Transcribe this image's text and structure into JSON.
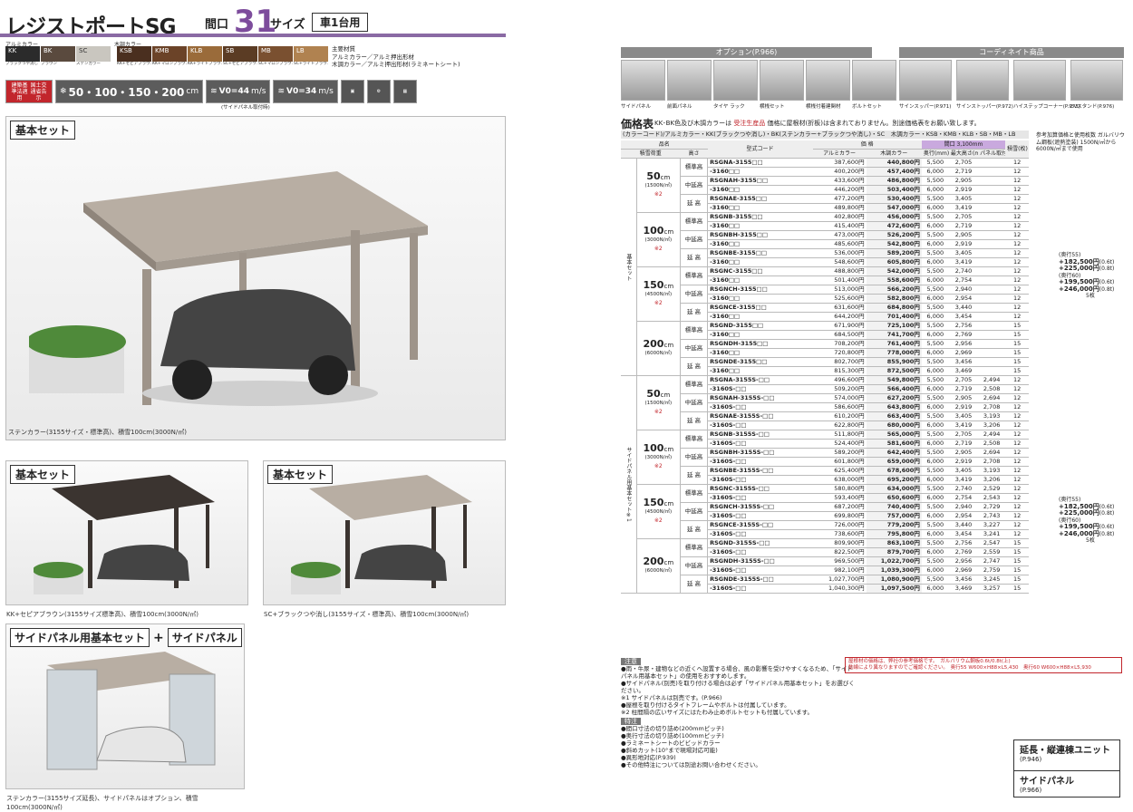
{
  "header": {
    "title": "レジストポートSG",
    "maguchi": "間口",
    "size_num": "31",
    "size_unit": "サイズ",
    "badge": "車1台用"
  },
  "colors": {
    "label_alumi": "アルミカラー",
    "label_wood": "木調カラー",
    "alumi": [
      {
        "code": "KK",
        "name": "ブラックつや消し",
        "hex": "#2b2b2b"
      },
      {
        "code": "BK",
        "name": "ブラウン",
        "hex": "#5a4a3e"
      },
      {
        "code": "SC",
        "name": "ステンカラー",
        "hex": "#c9c6bf"
      }
    ],
    "wood": [
      {
        "code": "KSB",
        "name": "KK+セピアブラウン",
        "hex": "#4a2f1f"
      },
      {
        "code": "KMB",
        "name": "KK+マロンブラウン",
        "hex": "#6b4328"
      },
      {
        "code": "KLB",
        "name": "KK+ライトブラウン",
        "hex": "#9a6b3a"
      },
      {
        "code": "SB",
        "name": "SC+セピアブラウン",
        "hex": "#5b3c24"
      },
      {
        "code": "MB",
        "name": "SC+マロンブラウン",
        "hex": "#7a5030"
      },
      {
        "code": "LB",
        "name": "SC+ライトブラウン",
        "hex": "#b08250"
      }
    ]
  },
  "material": {
    "label": "主要材質",
    "line1": "アルミカラー／アルミ押出形材",
    "line2": "木調カラー／アルミ押出形材(ラミネートシート)"
  },
  "icons": {
    "law": "建築基準法適用",
    "law_sub": "国土交通省告示",
    "snow": "50・100・150・200",
    "snow_unit": "cm",
    "wind1": "V0=44",
    "wind2": "V0=34",
    "unit": "m/s",
    "note": "(サイドパネル取付時)"
  },
  "panels": {
    "main_label": "基本セット",
    "main_caption": "ステンカラー(3155サイズ・標準高)、積雪100cm(3000N/㎡)",
    "p2_label": "基本セット",
    "p2_caption": "KK+セピアブラウン(3155サイズ標準高)、積雪100cm(3000N/㎡)",
    "p3_label": "基本セット",
    "p3_caption": "SC+ブラックつや消し(3155サイズ・標準高)、積雪100cm(3000N/㎡)",
    "p4_label1": "サイドパネル用基本セット",
    "p4_plus": "+",
    "p4_label2": "サイドパネル",
    "p4_caption": "ステンカラー(3155サイズ延長)、サイドパネルはオプション、積雪100cm(3000N/㎡)"
  },
  "options": {
    "head": "オプション(P.966)",
    "coord": "コーディネイト商品",
    "items": [
      "サイドパネル",
      "前面パネル",
      "タイヤ ラック",
      "横桟セット",
      "横桟付着建関材",
      "ボルトセット",
      "サインスッパー(P.971)",
      "サインストッパー(P.972)",
      "ハイステップコーナー(P.973)",
      "EVスタンド(P.976)"
    ]
  },
  "price": {
    "title": "価格表",
    "note1": "KK･BK色及び木調カラーは",
    "note_red": "受注生産品",
    "note2": "価格に屋根材(折板)は含まれておりません。別途価格表をお願い致します。",
    "kk_line": "(カラーコード)/アルミカラー・KK(ブラックつや消し)・BK(ステンカラー+ブラックつや消し)・SC　木調カラー・KSB・KMB・KLB・SB・MB・LB",
    "h": {
      "name": "品名",
      "snow": "積雪荷重",
      "height": "高さ",
      "code": "型式コード",
      "alumi": "アルミカラー",
      "wood": "木調カラー",
      "depth": "奥行(mm)",
      "maxh": "最大高さ(mm)",
      "panelh": "パネル取付高さ(mm)",
      "roof": "積雪(枚)",
      "maguchi": "間口 3,100mm"
    }
  },
  "groups": [
    {
      "label": "基本セット",
      "blocks": [
        {
          "snow": "50",
          "kN": "(1500N/㎡)",
          "star": "※2",
          "rows": [
            [
              "標準高",
              "RSGNA-3155□□",
              "387,600円",
              "440,800円",
              "5,500",
              "2,705",
              "12"
            ],
            [
              "",
              "-3160□□",
              "400,200円",
              "457,400円",
              "6,000",
              "2,719",
              "12"
            ],
            [
              "中延高",
              "RSGNAH-3155□□",
              "433,600円",
              "486,800円",
              "5,500",
              "2,905",
              "12"
            ],
            [
              "",
              "-3160□□",
              "446,200円",
              "503,400円",
              "6,000",
              "2,919",
              "12"
            ],
            [
              "延 高",
              "RSGNAE-3155□□",
              "477,200円",
              "530,400円",
              "5,500",
              "3,405",
              "12"
            ],
            [
              "",
              "-3160□□",
              "489,800円",
              "547,000円",
              "6,000",
              "3,419",
              "12"
            ]
          ]
        },
        {
          "snow": "100",
          "kN": "(3000N/㎡)",
          "star": "※2",
          "rows": [
            [
              "標準高",
              "RSGNB-3155□□",
              "402,800円",
              "456,000円",
              "5,500",
              "2,705",
              "12"
            ],
            [
              "",
              "-3160□□",
              "415,400円",
              "472,600円",
              "6,000",
              "2,719",
              "12"
            ],
            [
              "中延高",
              "RSGNBH-3155□□",
              "473,000円",
              "526,200円",
              "5,500",
              "2,905",
              "12"
            ],
            [
              "",
              "-3160□□",
              "485,600円",
              "542,800円",
              "6,000",
              "2,919",
              "12"
            ],
            [
              "延 高",
              "RSGNBE-3155□□",
              "536,000円",
              "589,200円",
              "5,500",
              "3,405",
              "12"
            ],
            [
              "",
              "-3160□□",
              "548,600円",
              "605,800円",
              "6,000",
              "3,419",
              "12"
            ]
          ]
        },
        {
          "snow": "150",
          "kN": "(4500N/㎡)",
          "star": "※2",
          "rows": [
            [
              "標準高",
              "RSGNC-3155□□",
              "488,800円",
              "542,000円",
              "5,500",
              "2,740",
              "12"
            ],
            [
              "",
              "-3160□□",
              "501,400円",
              "558,600円",
              "6,000",
              "2,754",
              "12"
            ],
            [
              "中延高",
              "RSGNCH-3155□□",
              "513,000円",
              "566,200円",
              "5,500",
              "2,940",
              "12"
            ],
            [
              "",
              "-3160□□",
              "525,600円",
              "582,800円",
              "6,000",
              "2,954",
              "12"
            ],
            [
              "延 高",
              "RSGNCE-3155□□",
              "631,600円",
              "684,800円",
              "5,500",
              "3,440",
              "12"
            ],
            [
              "",
              "-3160□□",
              "644,200円",
              "701,400円",
              "6,000",
              "3,454",
              "12"
            ]
          ]
        },
        {
          "snow": "200",
          "kN": "(6000N/㎡)",
          "star": "",
          "rows": [
            [
              "標準高",
              "RSGND-3155□□",
              "671,900円",
              "725,100円",
              "5,500",
              "2,756",
              "15"
            ],
            [
              "",
              "-3160□□",
              "684,500円",
              "741,700円",
              "6,000",
              "2,769",
              "15"
            ],
            [
              "中延高",
              "RSGNDH-3155□□",
              "708,200円",
              "761,400円",
              "5,500",
              "2,956",
              "15"
            ],
            [
              "",
              "-3160□□",
              "720,800円",
              "778,000円",
              "6,000",
              "2,969",
              "15"
            ],
            [
              "延 高",
              "RSGNDE-3155□□",
              "802,700円",
              "855,900円",
              "5,500",
              "3,456",
              "15"
            ],
            [
              "",
              "-3160□□",
              "815,300円",
              "872,500円",
              "6,000",
              "3,469",
              "15"
            ]
          ]
        }
      ]
    },
    {
      "label": "サイドパネル用基本セット※1",
      "blocks": [
        {
          "snow": "50",
          "kN": "(1500N/㎡)",
          "star": "※2",
          "rows": [
            [
              "標準高",
              "RSGNA-3155S-□□",
              "496,600円",
              "549,800円",
              "5,500",
              "2,705",
              "2,494",
              "12"
            ],
            [
              "",
              "-3160S-□□",
              "509,200円",
              "566,400円",
              "6,000",
              "2,719",
              "2,508",
              "12"
            ],
            [
              "中延高",
              "RSGNAH-3155S-□□",
              "574,000円",
              "627,200円",
              "5,500",
              "2,905",
              "2,694",
              "12"
            ],
            [
              "",
              "-3160S-□□",
              "586,600円",
              "643,800円",
              "6,000",
              "2,919",
              "2,708",
              "12"
            ],
            [
              "延 高",
              "RSGNAE-3155S-□□",
              "610,200円",
              "663,400円",
              "5,500",
              "3,405",
              "3,193",
              "12"
            ],
            [
              "",
              "-3160S-□□",
              "622,800円",
              "680,000円",
              "6,000",
              "3,419",
              "3,206",
              "12"
            ]
          ]
        },
        {
          "snow": "100",
          "kN": "(3000N/㎡)",
          "star": "※2",
          "rows": [
            [
              "標準高",
              "RSGNB-3155S-□□",
              "511,800円",
              "565,000円",
              "5,500",
              "2,705",
              "2,494",
              "12"
            ],
            [
              "",
              "-3160S-□□",
              "524,400円",
              "581,600円",
              "6,000",
              "2,719",
              "2,508",
              "12"
            ],
            [
              "中延高",
              "RSGNBH-3155S-□□",
              "589,200円",
              "642,400円",
              "5,500",
              "2,905",
              "2,694",
              "12"
            ],
            [
              "",
              "-3160S-□□",
              "601,800円",
              "659,000円",
              "6,000",
              "2,919",
              "2,708",
              "12"
            ],
            [
              "延 高",
              "RSGNBE-3155S-□□",
              "625,400円",
              "678,600円",
              "5,500",
              "3,405",
              "3,193",
              "12"
            ],
            [
              "",
              "-3160S-□□",
              "638,000円",
              "695,200円",
              "6,000",
              "3,419",
              "3,206",
              "12"
            ]
          ]
        },
        {
          "snow": "150",
          "kN": "(4500N/㎡)",
          "star": "※2",
          "rows": [
            [
              "標準高",
              "RSGNC-3155S-□□",
              "580,800円",
              "634,000円",
              "5,500",
              "2,740",
              "2,529",
              "12"
            ],
            [
              "",
              "-3160S-□□",
              "593,400円",
              "650,600円",
              "6,000",
              "2,754",
              "2,543",
              "12"
            ],
            [
              "中延高",
              "RSGNCH-3155S-□□",
              "687,200円",
              "740,400円",
              "5,500",
              "2,940",
              "2,729",
              "12"
            ],
            [
              "",
              "-3160S-□□",
              "699,800円",
              "757,000円",
              "6,000",
              "2,954",
              "2,743",
              "12"
            ],
            [
              "延 高",
              "RSGNCE-3155S-□□",
              "726,000円",
              "779,200円",
              "5,500",
              "3,440",
              "3,227",
              "12"
            ],
            [
              "",
              "-3160S-□□",
              "738,600円",
              "795,800円",
              "6,000",
              "3,454",
              "3,241",
              "12"
            ]
          ]
        },
        {
          "snow": "200",
          "kN": "(6000N/㎡)",
          "star": "",
          "rows": [
            [
              "標準高",
              "RSGND-3155S-□□",
              "809,900円",
              "863,100円",
              "5,500",
              "2,756",
              "2,547",
              "15"
            ],
            [
              "",
              "-3160S-□□",
              "822,500円",
              "879,700円",
              "6,000",
              "2,769",
              "2,559",
              "15"
            ],
            [
              "中延高",
              "RSGNDH-3155S-□□",
              "969,500円",
              "1,022,700円",
              "5,500",
              "2,956",
              "2,747",
              "15"
            ],
            [
              "",
              "-3160S-□□",
              "982,100円",
              "1,039,300円",
              "6,000",
              "2,969",
              "2,759",
              "15"
            ],
            [
              "延 高",
              "RSGNDE-3155S-□□",
              "1,027,700円",
              "1,080,900円",
              "5,500",
              "3,456",
              "3,245",
              "15"
            ],
            [
              "",
              "-3160S-□□",
              "1,040,300円",
              "1,097,500円",
              "6,000",
              "3,469",
              "3,257",
              "15"
            ]
          ]
        }
      ]
    }
  ],
  "side": {
    "head": "参考加算価格と使用枚数 ガルバリウム鋼板(遮熱塗装) 1500N/㎡から6000N/㎡まで使用",
    "b1a": "(奥行55)",
    "b1b": "+182,500円",
    "b1c": "+225,000円",
    "b1d": "(奥行60)",
    "b1e": "+199,500円",
    "b1f": "+246,000円",
    "b1g": "5枚",
    "tag": "(0.6t)",
    "tag2": "(0.8t)"
  },
  "notes": {
    "h1": "注意",
    "lines": [
      "●雨・牛尿・建物などの近くへ設置する場合、風の影響を受けやすくなるため、「サイドパネル用基本セット」の使用をおすすめします。",
      "●サイドパネル(別売)を取り付ける場合は必ず「サイドパネル用基本セット」をお選びください。",
      "※1 サイドパネルは別売です。(P.966)",
      "●屋根を取り付けるタイトフレームやボルトは付属しています。",
      "※2 柱間隔の広いサイズにはたわみ止めボルトセットも付属しています。"
    ],
    "h2": "特注",
    "sp": [
      "●間口寸法の切り詰め(200mmピッチ)",
      "●奥行寸法の切り詰め(100mmピッチ)",
      "●ラミネートシートのビビッドカラー",
      "●斜めカット(10°まで現場対応可能)",
      "●異形地対応(P.939)",
      "●その他特注については別途お問い合わせください。"
    ]
  },
  "reddnote": {
    "a": "屋根材の価格は、弊社の参考価格です。",
    "b": "動線により異なりますのでご確認ください。",
    "c": "ガルバリウム鋼板0.6t/0.8t(上)",
    "d": "奥行55 W600×H88×L5,430",
    "e": "奥行60 W600×H88×L5,930"
  },
  "links": [
    {
      "label": "延長・縦連棟ユニット",
      "page": "(P.946)"
    },
    {
      "label": "サイドパネル",
      "page": "(P.966)"
    }
  ]
}
